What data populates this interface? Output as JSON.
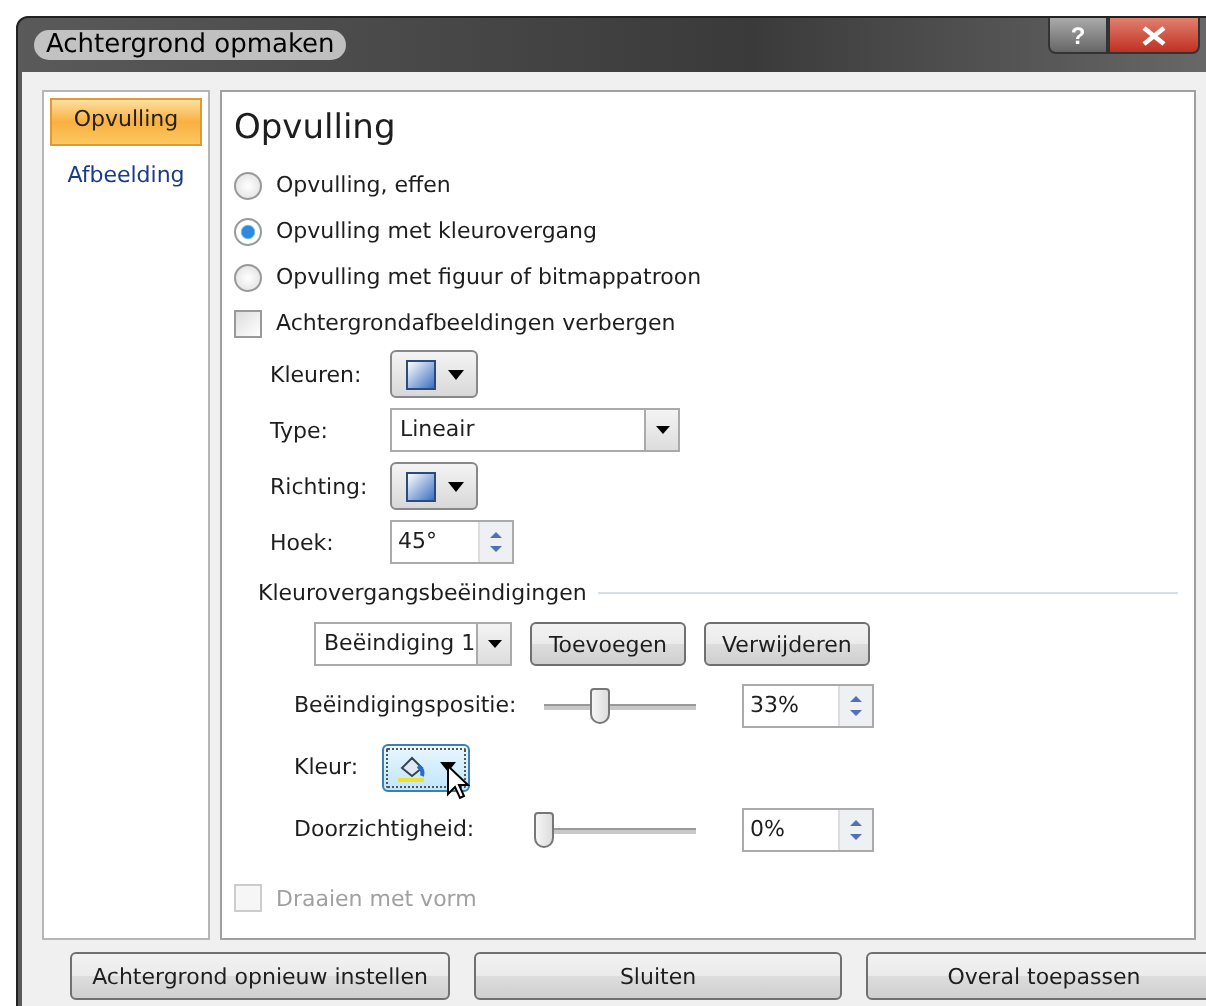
{
  "window": {
    "title": "Achtergrond opmaken",
    "help": "?"
  },
  "sidebar": {
    "items": [
      {
        "label": "Opvulling",
        "selected": true
      },
      {
        "label": "Afbeelding",
        "selected": false
      }
    ]
  },
  "panel": {
    "heading": "Opvulling",
    "fill_options": [
      {
        "label": "Opvulling, effen",
        "selected": false
      },
      {
        "label": "Opvulling met kleurovergang",
        "selected": true
      },
      {
        "label": "Opvulling met figuur of bitmappatroon",
        "selected": false
      }
    ],
    "hide_background": {
      "label": "Achtergrondafbeeldingen verbergen",
      "checked": false
    },
    "colors": {
      "label": "Kleuren:"
    },
    "type": {
      "label": "Type:",
      "value": "Lineair"
    },
    "direction": {
      "label": "Richting:"
    },
    "angle": {
      "label": "Hoek:",
      "value": "45°"
    },
    "stops": {
      "title": "Kleurovergangsbeëindigingen",
      "stop_select": "Beëindiging 1",
      "buttons": [
        "Toevoegen",
        "Verwijderen"
      ],
      "position": {
        "label": "Beëindigingspositie:",
        "level": 0.33,
        "value": "33%"
      },
      "color": {
        "label": "Kleur:"
      },
      "transparency": {
        "label": "Doorzichtigheid:",
        "level": 0,
        "value": "0%"
      }
    },
    "rotate_with_shape": {
      "label": "Draaien met vorm",
      "checked": false,
      "disabled": true
    }
  },
  "buttons": [
    "Achtergrond opnieuw instellen",
    "Sluiten",
    "Overal toepassen"
  ]
}
